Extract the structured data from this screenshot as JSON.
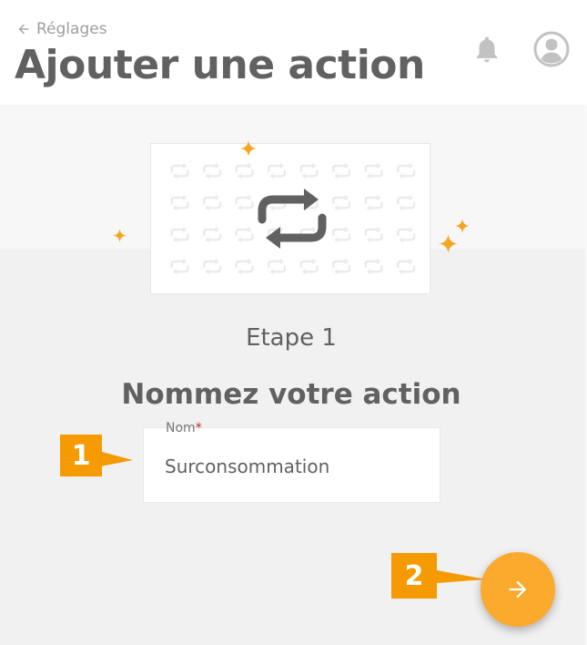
{
  "header": {
    "back_label": "Réglages",
    "title": "Ajouter une action",
    "icons": [
      "arrow-left-icon",
      "bell-icon",
      "account-circle-icon"
    ]
  },
  "illustration": {
    "icon": "repeat-icon",
    "pattern_icon": "repeat-icon",
    "decoration": "sparkle-icon"
  },
  "step": {
    "label": "Etape 1",
    "heading": "Nommez votre action"
  },
  "form": {
    "name_field": {
      "label": "Nom",
      "required_marker": "*",
      "value": "Surconsommation"
    }
  },
  "annotations": {
    "callout_1": "1",
    "callout_2": "2"
  },
  "actions": {
    "next_icon": "arrow-right-icon"
  },
  "colors": {
    "accent": "#fbaa2e",
    "callout": "#f59a00",
    "text": "#616161",
    "required": "#c62828"
  }
}
